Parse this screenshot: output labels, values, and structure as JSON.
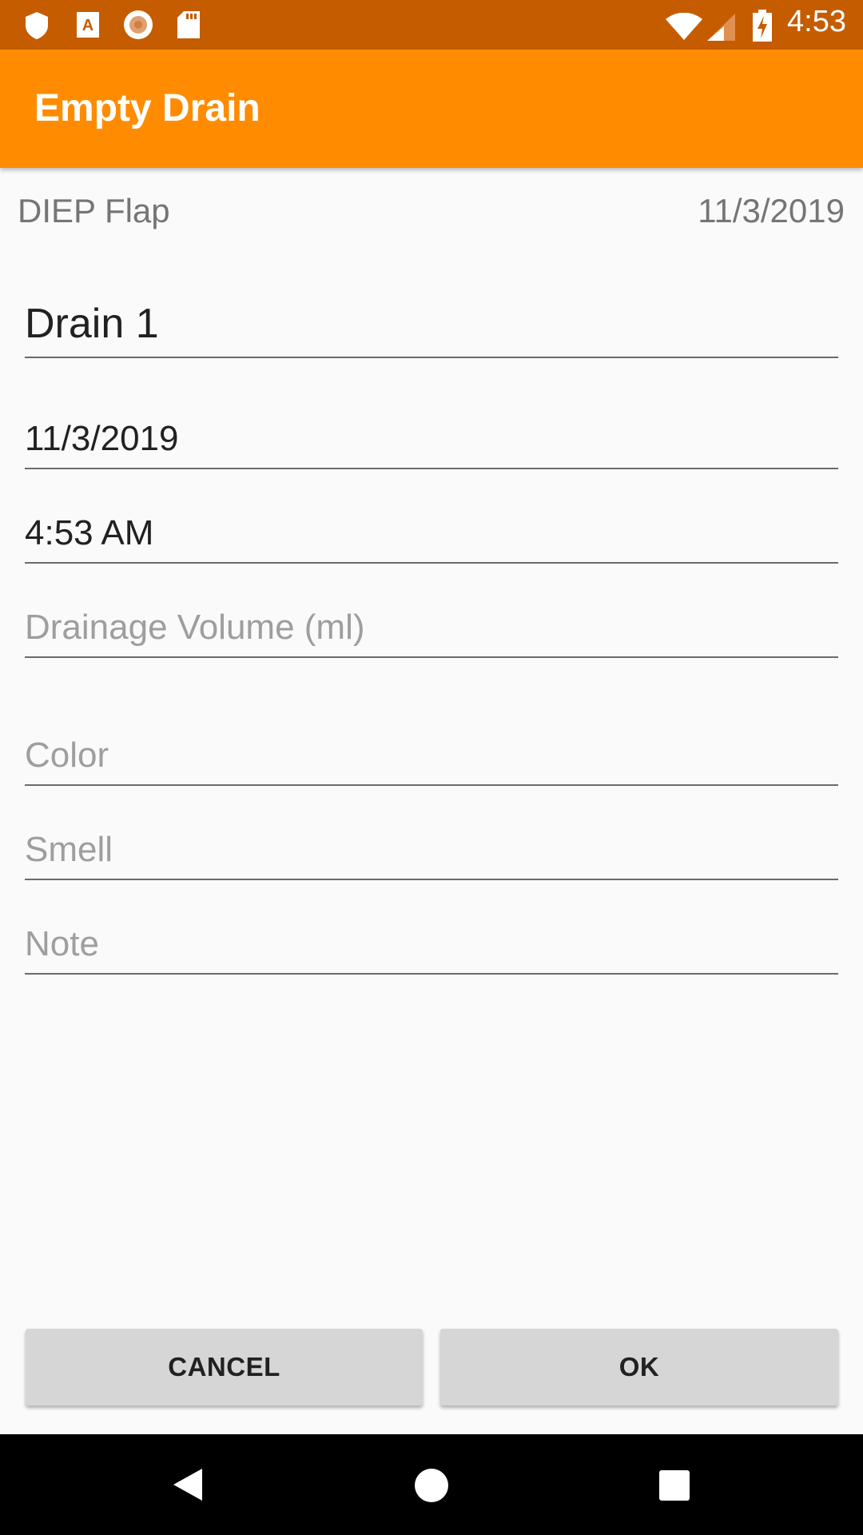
{
  "status_bar": {
    "time": "4:53",
    "icons": [
      "shield-icon",
      "app-a-icon",
      "record-icon",
      "sd-card-icon",
      "wifi-icon",
      "signal-icon",
      "battery-charging-icon"
    ]
  },
  "app_bar": {
    "title": "Empty Drain"
  },
  "header": {
    "procedure": "DIEP Flap",
    "date": "11/3/2019"
  },
  "form": {
    "drain_name": "Drain 1",
    "date": "11/3/2019",
    "time": "4:53 AM",
    "volume_placeholder": "Drainage Volume (ml)",
    "color_placeholder": "Color",
    "smell_placeholder": "Smell",
    "note_placeholder": "Note"
  },
  "buttons": {
    "cancel": "CANCEL",
    "ok": "OK"
  },
  "colors": {
    "status_bar": "#c55c00",
    "app_bar": "#ff8c00"
  }
}
